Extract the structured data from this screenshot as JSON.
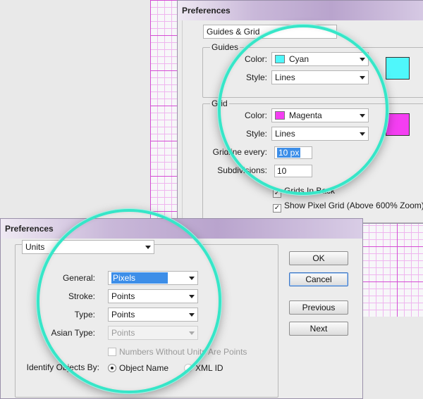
{
  "top_dialog": {
    "title": "Preferences",
    "section_select": "Guides & Grid",
    "guides": {
      "group_label": "Guides",
      "color_label": "Color:",
      "color_value": "Cyan",
      "color_hex": "#4ff7fb",
      "style_label": "Style:",
      "style_value": "Lines"
    },
    "grid": {
      "group_label": "Grid",
      "color_label": "Color:",
      "color_value": "Magenta",
      "color_hex": "#f43ef2",
      "style_label": "Style:",
      "style_value": "Lines",
      "gridline_label": "Gridline every:",
      "gridline_value": "10 px",
      "subdivisions_label": "Subdivisions:",
      "subdivisions_value": "10",
      "grids_in_back_label": "Grids In Back",
      "grids_in_back_checked": true,
      "show_pixel_grid_label": "Show Pixel Grid (Above 600% Zoom)",
      "show_pixel_grid_checked": true
    }
  },
  "bottom_dialog": {
    "title": "Preferences",
    "section_select": "Units",
    "units": {
      "general_label": "General:",
      "general_value": "Pixels",
      "stroke_label": "Stroke:",
      "stroke_value": "Points",
      "type_label": "Type:",
      "type_value": "Points",
      "asian_type_label": "Asian Type:",
      "asian_type_value": "Points",
      "numbers_without_units_label": "Numbers Without Units Are Points",
      "identify_label": "Identify Objects By:",
      "identify_option_1": "Object Name",
      "identify_option_2": "XML ID"
    },
    "buttons": {
      "ok": "OK",
      "cancel": "Cancel",
      "previous": "Previous",
      "next": "Next"
    }
  },
  "colors": {
    "lens_ring": "#36e6c8",
    "grid_major": "#d44dd4",
    "grid_minor": "#efb6ef",
    "selection": "#3d8ee8"
  }
}
